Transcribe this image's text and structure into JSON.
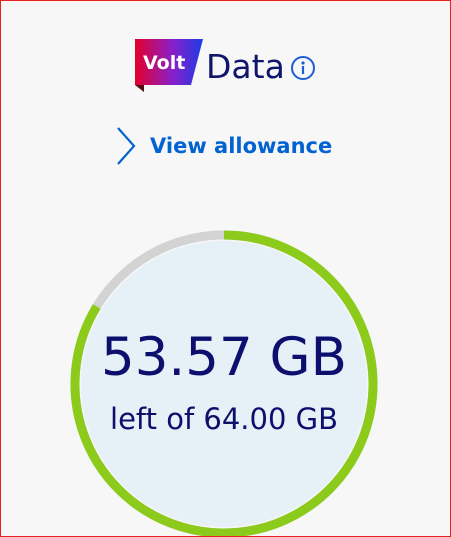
{
  "brand": {
    "logo_text": "Volt",
    "logo_gradient": [
      "#e4002b",
      "#6b1bd6",
      "#1e3ee8"
    ]
  },
  "header": {
    "title": "Data",
    "info_icon": "info-icon"
  },
  "view_allowance": {
    "label": "View allowance",
    "icon": "chevron-right-icon",
    "color": "#0063d1"
  },
  "usage": {
    "remaining_text": "53.57 GB",
    "total_text": "left of 64.00 GB",
    "remaining_gb": 53.57,
    "total_gb": 64.0,
    "ring_color_start": "#8ccb1b",
    "ring_track_color": "#d3d3d3",
    "inner_fill": "#e6f0f7"
  },
  "colors": {
    "text_primary": "#10146b",
    "border": "#e8231f",
    "background": "#f7f7f7"
  }
}
